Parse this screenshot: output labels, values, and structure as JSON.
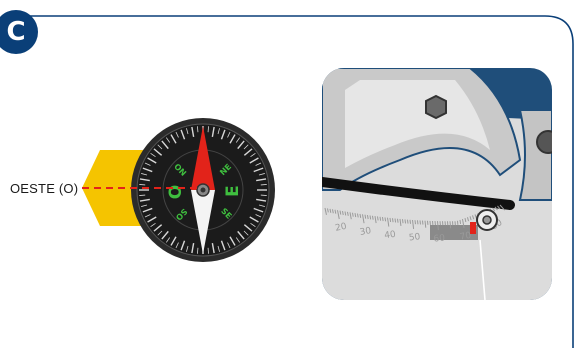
{
  "panel_label": "C",
  "direction_label": "OESTE (O)",
  "compass": {
    "cardinals": {
      "west": "O",
      "east": "E"
    },
    "intercardinals": {
      "ne": "NE",
      "no": "NO",
      "se": "SE",
      "so": "SO"
    }
  },
  "protractor": {
    "scale_labels": [
      "20",
      "30",
      "40",
      "50",
      "60",
      "70",
      "80"
    ],
    "indicated_value": 70
  },
  "colors": {
    "frame": "#0a3f78",
    "accent_yellow": "#f5c400",
    "needle_red": "#e2231a",
    "compass_green": "#3fbf3f",
    "saw_body": "#d9d9d9",
    "saw_outline": "#1f4e7a"
  }
}
